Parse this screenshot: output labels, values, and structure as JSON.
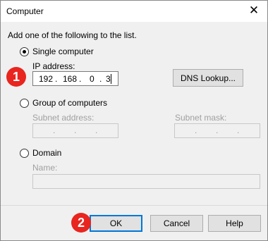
{
  "window": {
    "title": "Computer",
    "close_glyph": "✕"
  },
  "instruction": "Add one of the following to the list.",
  "single": {
    "label": "Single computer",
    "selected": true,
    "ip_label": "IP address:",
    "ip": [
      "192",
      "168",
      "0",
      "3"
    ],
    "dns_button": "DNS Lookup..."
  },
  "group": {
    "label": "Group of computers",
    "selected": false,
    "subnet_address_label": "Subnet address:",
    "subnet_mask_label": "Subnet mask:"
  },
  "domain": {
    "label": "Domain",
    "selected": false,
    "name_label": "Name:",
    "name_value": ""
  },
  "buttons": {
    "ok": "OK",
    "cancel": "Cancel",
    "help": "Help"
  },
  "badges": {
    "first": "1",
    "second": "2"
  },
  "colors": {
    "badge": "#e8251e",
    "focus_border": "#0078d7"
  },
  "icons": {
    "close": "close-icon"
  }
}
